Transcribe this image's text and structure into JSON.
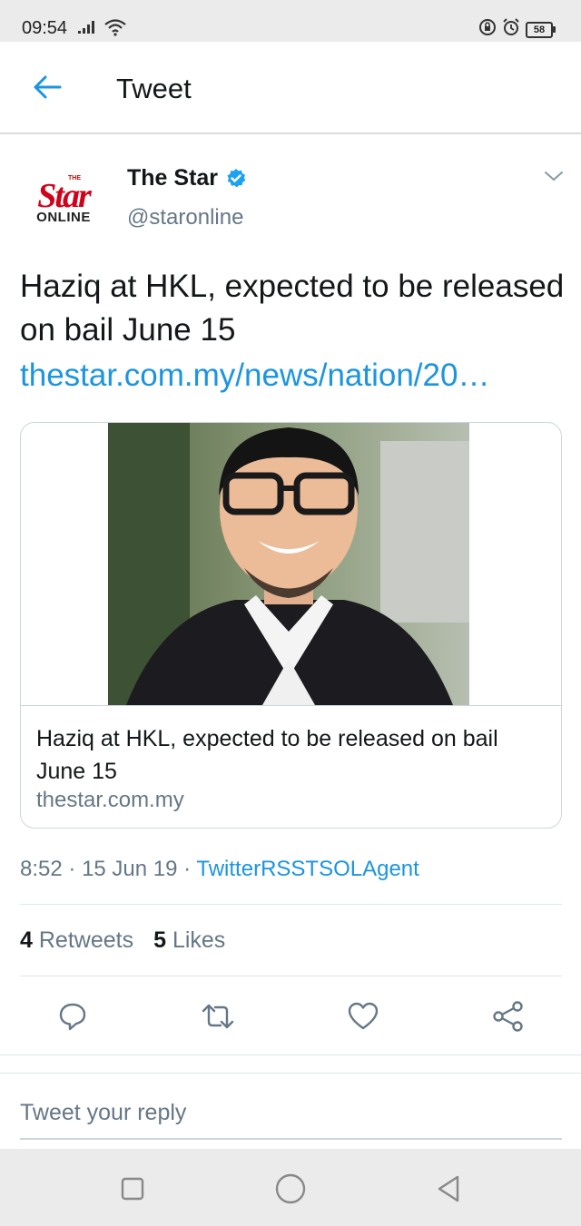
{
  "status_bar": {
    "time": "09:54",
    "battery": "58"
  },
  "header": {
    "title": "Tweet"
  },
  "author": {
    "avatar_logo_top": "THE",
    "avatar_logo_main": "Star",
    "avatar_logo_bottom": "ONLINE",
    "display_name": "The Star",
    "handle": "@staronline",
    "verified": true
  },
  "tweet": {
    "text": "Haziq at HKL, expected to be released on bail June 15",
    "link": "thestar.com.my/news/nation/20…"
  },
  "card": {
    "title": "Haziq at HKL, expected to be released on bail June 15",
    "domain": "thestar.com.my"
  },
  "meta": {
    "time": "8:52",
    "date": "15 Jun 19",
    "source": "TwitterRSSTSOLAgent"
  },
  "stats": {
    "retweets_count": "4",
    "retweets_label": "Retweets",
    "likes_count": "5",
    "likes_label": "Likes"
  },
  "actions": {
    "icons": [
      "reply-icon",
      "retweet-icon",
      "like-icon",
      "share-icon"
    ]
  },
  "reply": {
    "placeholder": "Tweet your reply"
  },
  "colors": {
    "accent": "#1b95e0",
    "text": "#14171a",
    "secondary": "#657786",
    "brand_red": "#d0021b"
  }
}
